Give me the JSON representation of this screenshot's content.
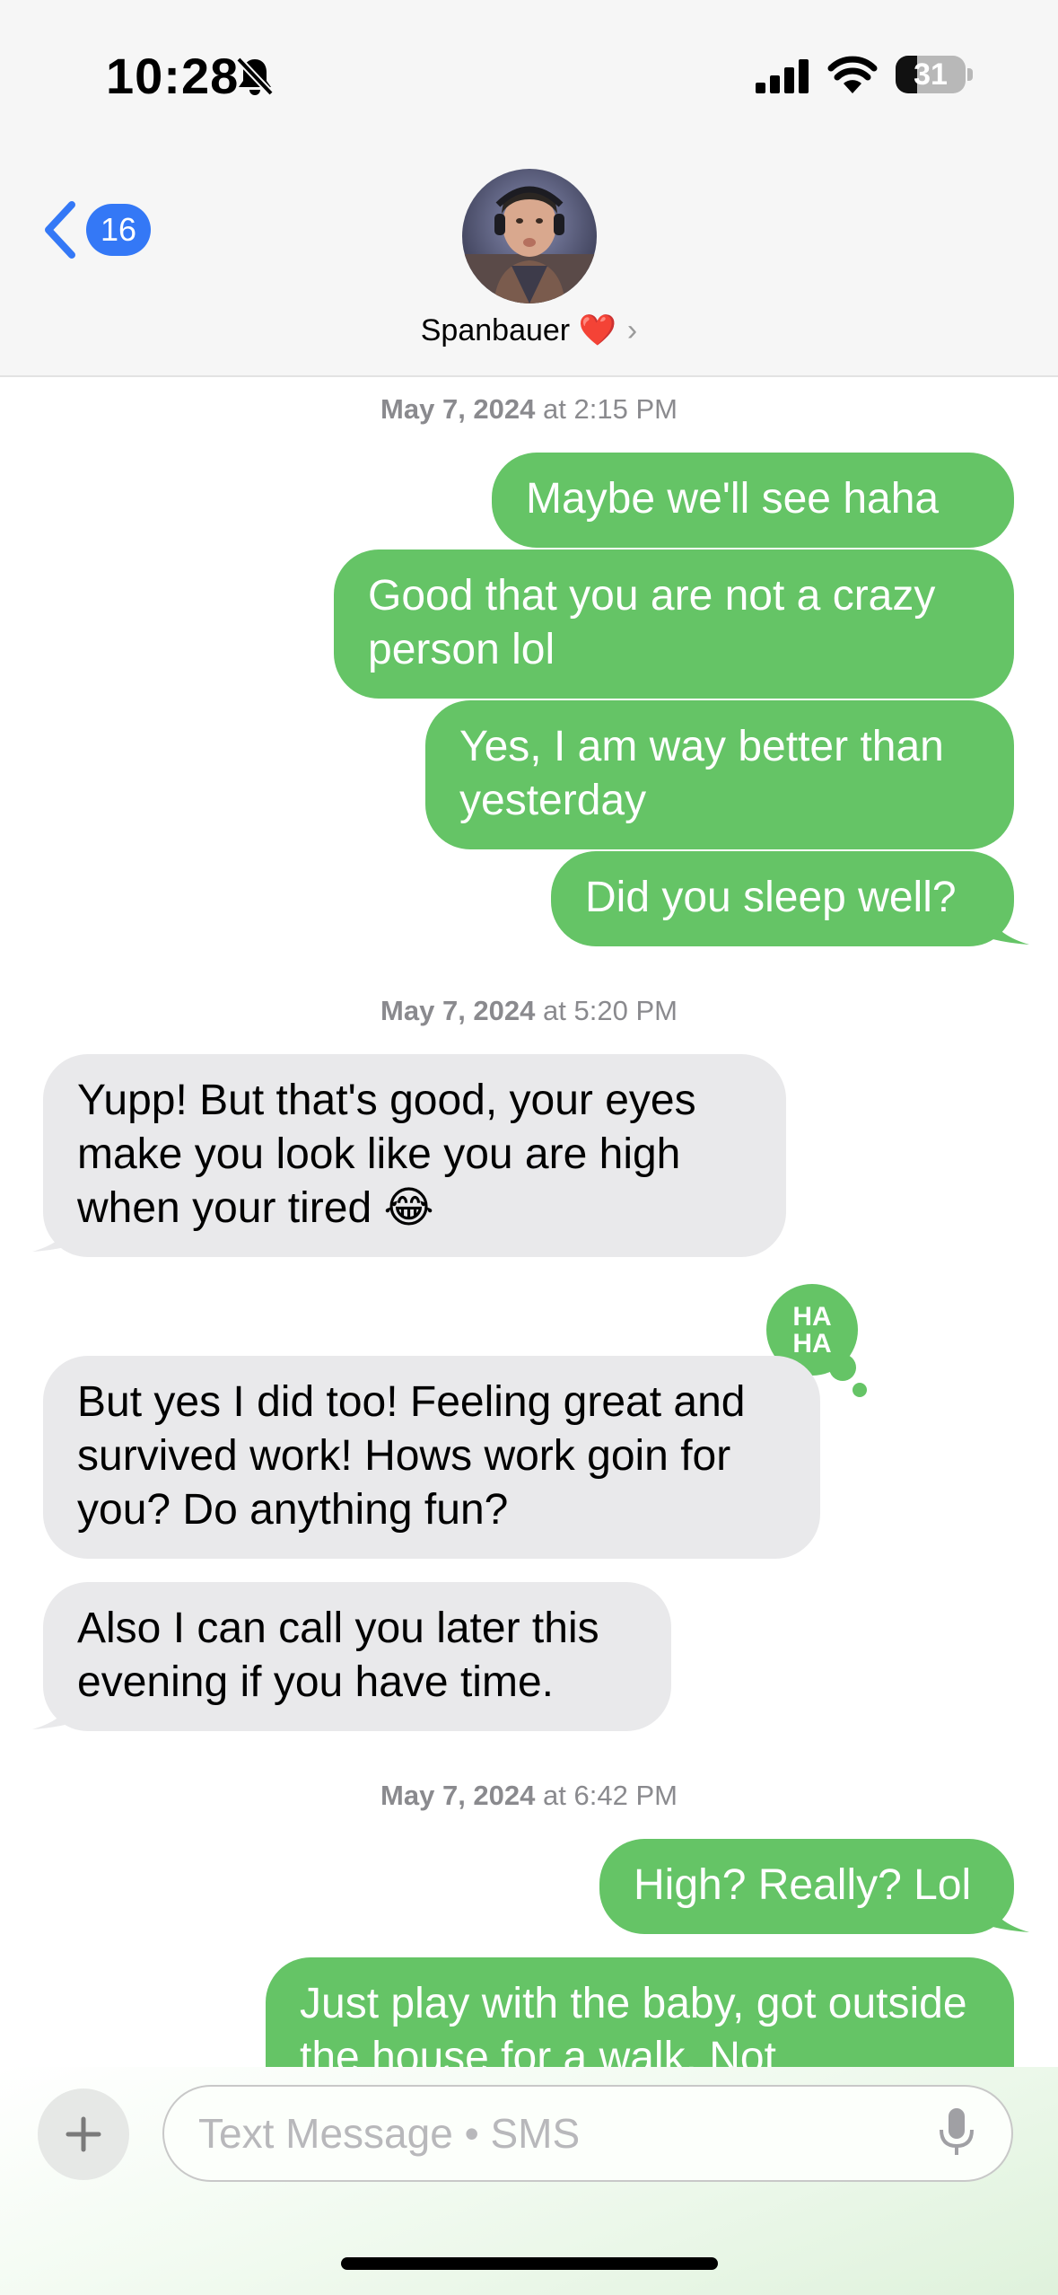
{
  "status_bar": {
    "time": "10:28",
    "battery": "31",
    "battery_level_percent": 31,
    "icons": [
      "bell-slash-icon",
      "cellular-signal-icon",
      "wifi-icon",
      "battery-icon"
    ]
  },
  "nav": {
    "back_badge": "16",
    "contact_name": "Spanbauer ❤️",
    "contact_chevron": "›"
  },
  "messages": {
    "ts1": {
      "date": "May 7, 2024",
      "sep": " at ",
      "time": "2:15 PM"
    },
    "m1": "Maybe we'll see haha",
    "m2": "Good that you are not a crazy person lol",
    "m3": "Yes, I am way better than yesterday",
    "m4": "Did you sleep well?",
    "ts2": {
      "date": "May 7, 2024",
      "sep": " at ",
      "time": "5:20 PM"
    },
    "m5": "Yupp! But that's good, your eyes make you look like you are high when your tired 😂",
    "tapback": "HA\nHA",
    "m6": "But yes I did too! Feeling great and survived work! Hows work goin for you? Do anything fun?",
    "m7": "Also I can call you later this evening if you have time.",
    "ts3": {
      "date": "May 7, 2024",
      "sep": " at ",
      "time": "6:42 PM"
    },
    "m8": "High? Really? Lol",
    "m9": "Just play with the baby, got outside the house for a walk. Not"
  },
  "composer": {
    "placeholder": "Text Message • SMS"
  },
  "colors": {
    "outgoing": "#65c466",
    "incoming": "#e9e9eb",
    "accent": "#3478f6"
  }
}
